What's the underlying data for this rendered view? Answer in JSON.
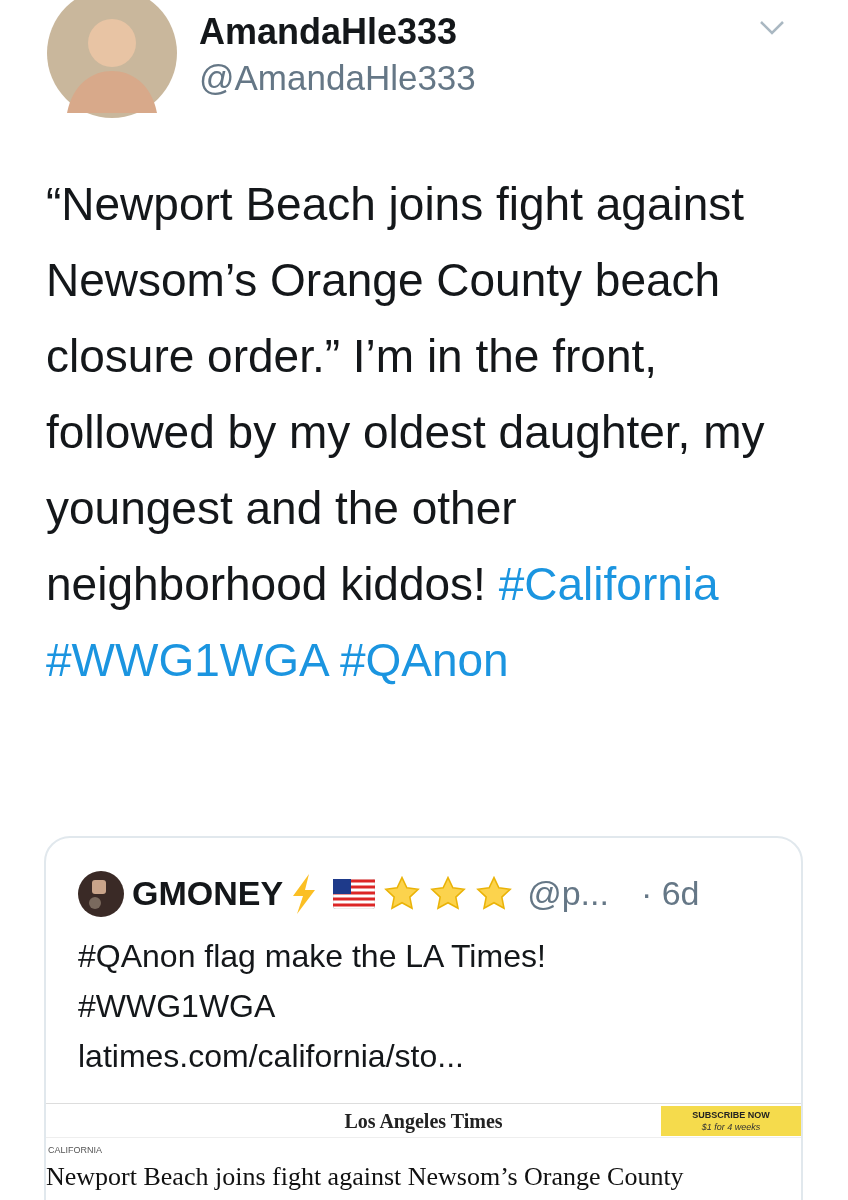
{
  "author": {
    "name": "AmandaHle333",
    "handle": "@AmandaHle333"
  },
  "body": [
    {
      "kind": "text",
      "text": "“Newport Beach joins fight against Newsom’s Orange County beach closure order.” I’m in the front, followed by my oldest daughter, my youngest and the other neighborhood kiddos! "
    },
    {
      "kind": "hashtag",
      "text": "#California"
    },
    {
      "kind": "hashtag",
      "text": "#WWG1WGA"
    },
    {
      "kind": "hashtag",
      "text": "#QAnon"
    }
  ],
  "quote": {
    "name": "GMONEY",
    "handle": "@p...",
    "time": "· 6d",
    "lines": [
      "#QAnon flag make the LA Times!",
      "#WWG1WGA",
      "latimes.com/california/sto..."
    ],
    "article": {
      "masthead": "Los Angeles Times",
      "subscribe": "SUBSCRIBE NOW",
      "offer": "$1 for 4 weeks",
      "section": "CALIFORNIA",
      "headline": "Newport Beach joins fight against Newsom’s Orange County"
    }
  }
}
